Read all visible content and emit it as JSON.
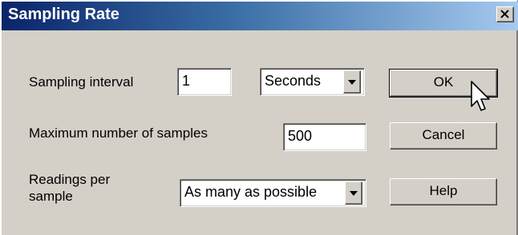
{
  "window": {
    "title": "Sampling Rate",
    "close_icon": "close-icon",
    "colors": {
      "face": "#d4d0c8",
      "title_start": "#0a246a",
      "title_end": "#a6caf0"
    }
  },
  "form": {
    "sampling_interval": {
      "label": "Sampling interval",
      "value": "1",
      "unit_selected": "Seconds"
    },
    "max_samples": {
      "label": "Maximum number of samples",
      "value": "500"
    },
    "readings_per_sample": {
      "label_line1": "Readings per",
      "label_line2": "sample",
      "selected": "As many as possible"
    }
  },
  "buttons": {
    "ok": "OK",
    "cancel": "Cancel",
    "help": "Help"
  },
  "cursor": "mouse-pointer-icon"
}
